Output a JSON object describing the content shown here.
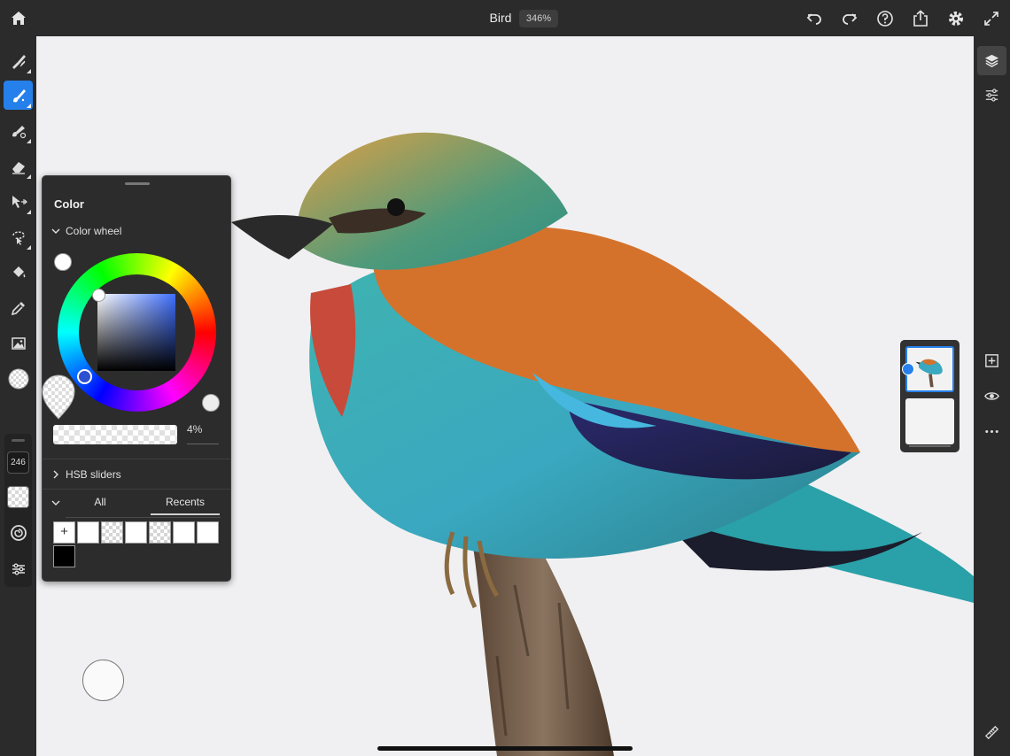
{
  "app": {
    "document_title": "Bird",
    "zoom_level": "346%"
  },
  "topbar": {
    "icons": [
      "home-icon",
      "undo-icon",
      "redo-icon",
      "help-icon",
      "share-icon",
      "settings-icon",
      "fullscreen-icon"
    ]
  },
  "left_toolbar": {
    "tools": [
      "paint-brush-tool",
      "brush-tool",
      "healing-brush-tool",
      "eraser-tool",
      "move-tool",
      "selection-tool",
      "paint-bucket-tool",
      "eyedropper-tool",
      "place-image-tool",
      "color-picker-swatch"
    ],
    "active_tool": "brush-tool",
    "brush_size": "246"
  },
  "color_panel": {
    "title": "Color",
    "wheel_section_label": "Color wheel",
    "opacity_value": "4%",
    "hsb_section_label": "HSB sliders",
    "tabs": [
      "All",
      "Recents"
    ],
    "active_tab": "Recents",
    "add_swatch_label": "+",
    "accent": "#2680eb"
  },
  "right_toolbar": {
    "icons": [
      "layers-icon",
      "adjustments-icon",
      "add-layer-icon",
      "visibility-icon",
      "more-icon",
      "ruler-icon"
    ]
  },
  "layers": {
    "count": 2
  },
  "colors": {
    "accent": "#2680eb",
    "toolbar_bg": "#2b2b2b",
    "canvas_bg": "#f0f0f2"
  }
}
